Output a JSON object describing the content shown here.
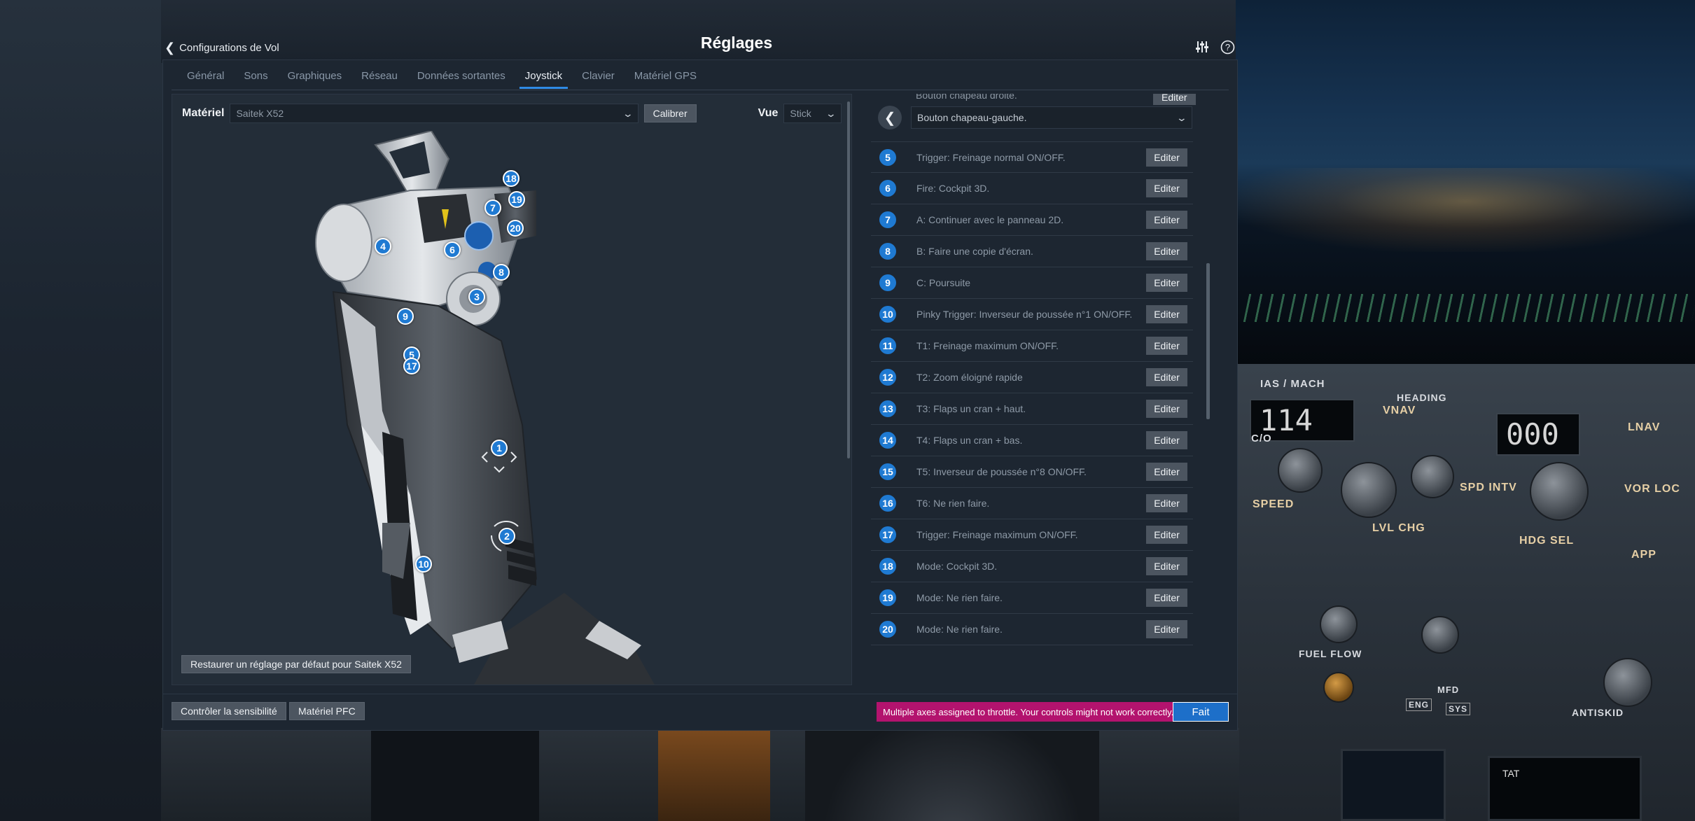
{
  "header": {
    "back_label": "Configurations de Vol",
    "title": "Réglages",
    "icons": [
      "sliders-icon",
      "help-icon"
    ]
  },
  "tabs": [
    {
      "label": "Général",
      "active": false
    },
    {
      "label": "Sons",
      "active": false
    },
    {
      "label": "Graphiques",
      "active": false
    },
    {
      "label": "Réseau",
      "active": false
    },
    {
      "label": "Données sortantes",
      "active": false
    },
    {
      "label": "Joystick",
      "active": true
    },
    {
      "label": "Clavier",
      "active": false
    },
    {
      "label": "Matériel GPS",
      "active": false
    }
  ],
  "hardware": {
    "label": "Matériel",
    "selected": "Saitek X52",
    "calibrate_label": "Calibrer",
    "view_label": "Vue",
    "view_selected": "Stick",
    "restore_label": "Restaurer un réglage par défaut pour Saitek X52"
  },
  "joystick_markers": {
    "m18": "18",
    "m19": "19",
    "m20": "20",
    "m7": "7",
    "m4": "4",
    "m6": "6",
    "m8": "8",
    "m3": "3",
    "m9": "9",
    "m5": "5",
    "m17": "17",
    "m1": "1",
    "m2": "2",
    "m10": "10"
  },
  "assignments": {
    "cut_off_label": "Bouton chapeau droite.",
    "cut_off_edit": "Editer",
    "current_select": "Bouton chapeau-gauche.",
    "edit_label": "Editer",
    "rows": [
      {
        "num": "5",
        "text": "Trigger: Freinage normal ON/OFF."
      },
      {
        "num": "6",
        "text": "Fire: Cockpit 3D."
      },
      {
        "num": "7",
        "text": "A: Continuer avec le panneau 2D."
      },
      {
        "num": "8",
        "text": "B: Faire une copie d'écran."
      },
      {
        "num": "9",
        "text": "C: Poursuite"
      },
      {
        "num": "10",
        "text": "Pinky Trigger: Inverseur de poussée n°1 ON/OFF."
      },
      {
        "num": "11",
        "text": "T1: Freinage maximum ON/OFF."
      },
      {
        "num": "12",
        "text": "T2: Zoom éloigné rapide"
      },
      {
        "num": "13",
        "text": "T3: Flaps un cran + haut."
      },
      {
        "num": "14",
        "text": "T4: Flaps un cran + bas."
      },
      {
        "num": "15",
        "text": "T5: Inverseur de poussée n°8 ON/OFF."
      },
      {
        "num": "16",
        "text": "T6: Ne rien faire."
      },
      {
        "num": "17",
        "text": "Trigger: Freinage maximum ON/OFF."
      },
      {
        "num": "18",
        "text": "Mode: Cockpit 3D."
      },
      {
        "num": "19",
        "text": "Mode: Ne rien faire."
      },
      {
        "num": "20",
        "text": "Mode: Ne rien faire."
      }
    ]
  },
  "footer": {
    "sensitivity_label": "Contrôler la sensibilité",
    "pfc_label": "Matériel PFC",
    "warning": "Multiple axes assigned to throttle. Your controls might not work correctly.",
    "done_label": "Fait"
  },
  "cockpit": {
    "ias_mach_label": "IAS / MACH",
    "ias_value": "114",
    "heading_label": "HEADING",
    "heading_value": "000",
    "vnav": "VNAV",
    "lnav": "LNAV",
    "co": "C/O",
    "spd_intv": "SPD INTV",
    "speed": "SPEED",
    "lvl_chg": "LVL CHG",
    "hdg_sel": "HDG SEL",
    "vor_loc": "VOR LOC",
    "app": "APP",
    "fuel_flow": "FUEL FLOW",
    "antiskid": "ANTISKID",
    "mfd": "MFD",
    "eng": "ENG",
    "sys": "SYS",
    "tat": "TAT"
  },
  "colors": {
    "accent": "#1f7ad2",
    "warning_bg": "#b3136e",
    "dialog_bg": "#1d2631"
  }
}
